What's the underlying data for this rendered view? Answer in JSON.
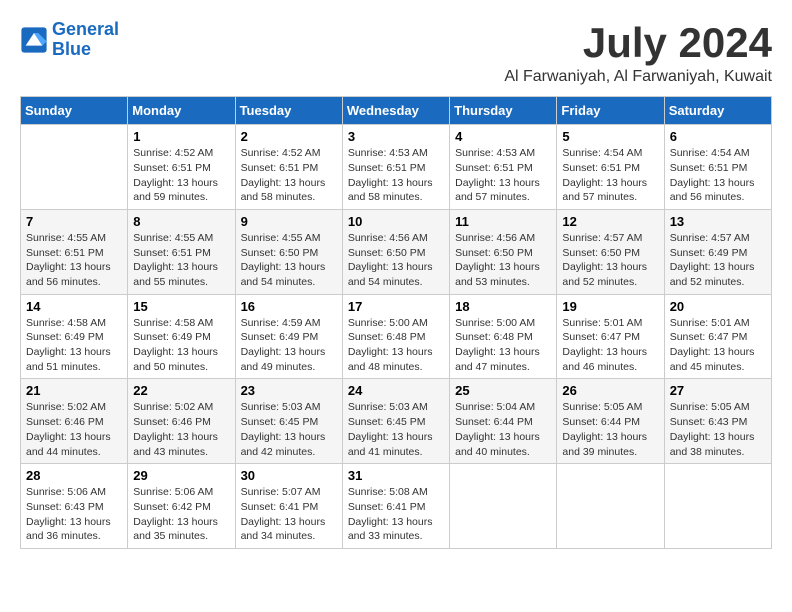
{
  "logo": {
    "line1": "General",
    "line2": "Blue"
  },
  "title": "July 2024",
  "location": "Al Farwaniyah, Al Farwaniyah, Kuwait",
  "days_header": [
    "Sunday",
    "Monday",
    "Tuesday",
    "Wednesday",
    "Thursday",
    "Friday",
    "Saturday"
  ],
  "weeks": [
    [
      {
        "day": "",
        "info": ""
      },
      {
        "day": "1",
        "info": "Sunrise: 4:52 AM\nSunset: 6:51 PM\nDaylight: 13 hours\nand 59 minutes."
      },
      {
        "day": "2",
        "info": "Sunrise: 4:52 AM\nSunset: 6:51 PM\nDaylight: 13 hours\nand 58 minutes."
      },
      {
        "day": "3",
        "info": "Sunrise: 4:53 AM\nSunset: 6:51 PM\nDaylight: 13 hours\nand 58 minutes."
      },
      {
        "day": "4",
        "info": "Sunrise: 4:53 AM\nSunset: 6:51 PM\nDaylight: 13 hours\nand 57 minutes."
      },
      {
        "day": "5",
        "info": "Sunrise: 4:54 AM\nSunset: 6:51 PM\nDaylight: 13 hours\nand 57 minutes."
      },
      {
        "day": "6",
        "info": "Sunrise: 4:54 AM\nSunset: 6:51 PM\nDaylight: 13 hours\nand 56 minutes."
      }
    ],
    [
      {
        "day": "7",
        "info": "Sunrise: 4:55 AM\nSunset: 6:51 PM\nDaylight: 13 hours\nand 56 minutes."
      },
      {
        "day": "8",
        "info": "Sunrise: 4:55 AM\nSunset: 6:51 PM\nDaylight: 13 hours\nand 55 minutes."
      },
      {
        "day": "9",
        "info": "Sunrise: 4:55 AM\nSunset: 6:50 PM\nDaylight: 13 hours\nand 54 minutes."
      },
      {
        "day": "10",
        "info": "Sunrise: 4:56 AM\nSunset: 6:50 PM\nDaylight: 13 hours\nand 54 minutes."
      },
      {
        "day": "11",
        "info": "Sunrise: 4:56 AM\nSunset: 6:50 PM\nDaylight: 13 hours\nand 53 minutes."
      },
      {
        "day": "12",
        "info": "Sunrise: 4:57 AM\nSunset: 6:50 PM\nDaylight: 13 hours\nand 52 minutes."
      },
      {
        "day": "13",
        "info": "Sunrise: 4:57 AM\nSunset: 6:49 PM\nDaylight: 13 hours\nand 52 minutes."
      }
    ],
    [
      {
        "day": "14",
        "info": "Sunrise: 4:58 AM\nSunset: 6:49 PM\nDaylight: 13 hours\nand 51 minutes."
      },
      {
        "day": "15",
        "info": "Sunrise: 4:58 AM\nSunset: 6:49 PM\nDaylight: 13 hours\nand 50 minutes."
      },
      {
        "day": "16",
        "info": "Sunrise: 4:59 AM\nSunset: 6:49 PM\nDaylight: 13 hours\nand 49 minutes."
      },
      {
        "day": "17",
        "info": "Sunrise: 5:00 AM\nSunset: 6:48 PM\nDaylight: 13 hours\nand 48 minutes."
      },
      {
        "day": "18",
        "info": "Sunrise: 5:00 AM\nSunset: 6:48 PM\nDaylight: 13 hours\nand 47 minutes."
      },
      {
        "day": "19",
        "info": "Sunrise: 5:01 AM\nSunset: 6:47 PM\nDaylight: 13 hours\nand 46 minutes."
      },
      {
        "day": "20",
        "info": "Sunrise: 5:01 AM\nSunset: 6:47 PM\nDaylight: 13 hours\nand 45 minutes."
      }
    ],
    [
      {
        "day": "21",
        "info": "Sunrise: 5:02 AM\nSunset: 6:46 PM\nDaylight: 13 hours\nand 44 minutes."
      },
      {
        "day": "22",
        "info": "Sunrise: 5:02 AM\nSunset: 6:46 PM\nDaylight: 13 hours\nand 43 minutes."
      },
      {
        "day": "23",
        "info": "Sunrise: 5:03 AM\nSunset: 6:45 PM\nDaylight: 13 hours\nand 42 minutes."
      },
      {
        "day": "24",
        "info": "Sunrise: 5:03 AM\nSunset: 6:45 PM\nDaylight: 13 hours\nand 41 minutes."
      },
      {
        "day": "25",
        "info": "Sunrise: 5:04 AM\nSunset: 6:44 PM\nDaylight: 13 hours\nand 40 minutes."
      },
      {
        "day": "26",
        "info": "Sunrise: 5:05 AM\nSunset: 6:44 PM\nDaylight: 13 hours\nand 39 minutes."
      },
      {
        "day": "27",
        "info": "Sunrise: 5:05 AM\nSunset: 6:43 PM\nDaylight: 13 hours\nand 38 minutes."
      }
    ],
    [
      {
        "day": "28",
        "info": "Sunrise: 5:06 AM\nSunset: 6:43 PM\nDaylight: 13 hours\nand 36 minutes."
      },
      {
        "day": "29",
        "info": "Sunrise: 5:06 AM\nSunset: 6:42 PM\nDaylight: 13 hours\nand 35 minutes."
      },
      {
        "day": "30",
        "info": "Sunrise: 5:07 AM\nSunset: 6:41 PM\nDaylight: 13 hours\nand 34 minutes."
      },
      {
        "day": "31",
        "info": "Sunrise: 5:08 AM\nSunset: 6:41 PM\nDaylight: 13 hours\nand 33 minutes."
      },
      {
        "day": "",
        "info": ""
      },
      {
        "day": "",
        "info": ""
      },
      {
        "day": "",
        "info": ""
      }
    ]
  ]
}
